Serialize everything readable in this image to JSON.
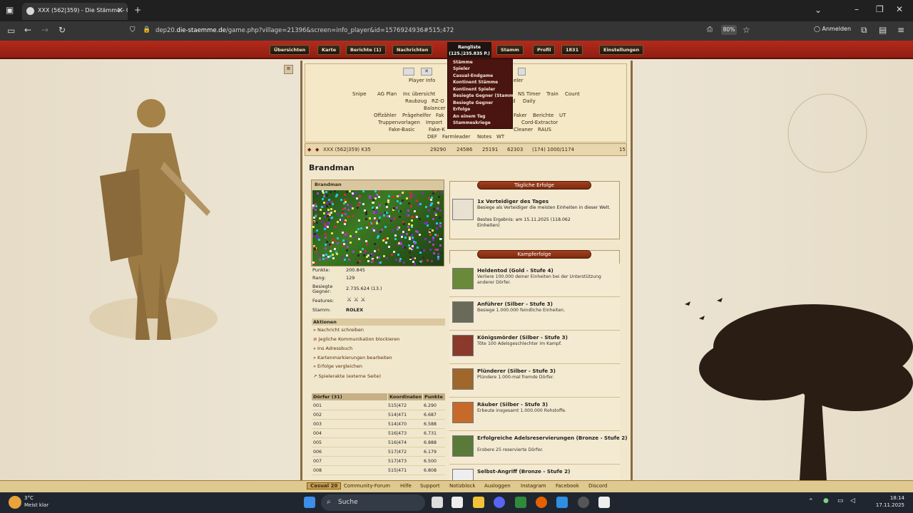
{
  "browser": {
    "tab_title": "XXX (562|359) - Die Stämme - C",
    "url_prefix": "dep20.",
    "url_domain": "die-staemme.de",
    "url_path": "/game.php?village=21396&screen=info_player&id=1576924936#515;472",
    "zoom": "80%",
    "signin": "Anmelden"
  },
  "topbar": {
    "items": [
      "Übersichten",
      "Karte",
      "Berichte (1)",
      "Nachrichten",
      "Stamm",
      "Profil",
      "1831",
      "Einstellungen"
    ],
    "ranking_label": "Rangliste",
    "ranking_sub": "(125.|235.835 P.)"
  },
  "ranking_menu": [
    "Stämme",
    "Spieler",
    "Casual-Endgame",
    "Kontinent Stämme",
    "Kontinent Spieler",
    "Besiegte Gegner (Stamm)",
    "Besiegte Gegner",
    "Erfolge",
    "An einem Tag",
    "Stammeskriege"
  ],
  "tools": {
    "r1": "Player Info",
    "r1b": "eler",
    "r2": [
      "Snipe",
      "AG Plan",
      "Inc übersicht"
    ],
    "r2b": [
      "NS Timer",
      "Train",
      "Count"
    ],
    "r3": [
      "Raubzug",
      "RZ-O"
    ],
    "r3b": [
      "d",
      "Daily"
    ],
    "r4": "Balancer",
    "r5": [
      "Offzähler",
      "Prägehelfer",
      "Fak"
    ],
    "r5b": [
      "Faker",
      "Berichte",
      "UT"
    ],
    "r6": [
      "Truppenvorlagen",
      "Import"
    ],
    "r6b": "Cord-Extractor",
    "r7": [
      "Fake-Basic",
      "Fake-K"
    ],
    "r7b": [
      "Cleaner",
      "RAUS"
    ],
    "r8": [
      "DEF",
      "Farmleader",
      "Notes",
      "WT"
    ]
  },
  "infobar": {
    "village": "XXX (562|359) K35",
    "wood": "29290",
    "clay": "24586",
    "iron": "25191",
    "storage": "62303",
    "pop": "(174) 1000/1174",
    "count": "15"
  },
  "player": {
    "name": "Brandman",
    "card_name": "Brandman",
    "labels": {
      "points": "Punkte:",
      "rank": "Rang:",
      "defeated": "Besiegte Gegner:",
      "features": "Features:",
      "tribe": "Stamm:"
    },
    "points": "200.845",
    "rank": "129",
    "defeated": "2.735.624 (13.)",
    "tribe": "ROLEX"
  },
  "actions": {
    "title": "Aktionen",
    "items": [
      "Nachricht schreiben",
      "Jegliche Kommunikation blockieren",
      "Ins Adressbuch",
      "Kartenmarkierungen bearbeiten",
      "Erfolge vergleichen",
      "Spielerakte (externe Seite)"
    ]
  },
  "villages": {
    "headers": [
      "Dörfer (31)",
      "Koordinaten",
      "Punkte"
    ],
    "rows": [
      {
        "name": "001",
        "coords": "515|472",
        "points": "6.290"
      },
      {
        "name": "002",
        "coords": "514|471",
        "points": "6.687"
      },
      {
        "name": "003",
        "coords": "514|470",
        "points": "6.588"
      },
      {
        "name": "004",
        "coords": "516|473",
        "points": "6.731"
      },
      {
        "name": "005",
        "coords": "516|474",
        "points": "6.888"
      },
      {
        "name": "006",
        "coords": "517|472",
        "points": "6.179"
      },
      {
        "name": "007",
        "coords": "517|473",
        "points": "6.500"
      },
      {
        "name": "008",
        "coords": "515|471",
        "points": "6.808"
      }
    ]
  },
  "daily": {
    "title": "Tägliche Erfolge",
    "name": "1x Verteidiger des Tages",
    "desc": "Besiege als Verteidiger die meisten Einheiten in dieser Welt.",
    "best": "Bestes Ergebnis: am 15.11.2025 (118.062 Einheiten)"
  },
  "combat": {
    "title": "Kampferfolge",
    "items": [
      {
        "name": "Heldentod (Gold - Stufe 4)",
        "desc": "Verliere 100.000 deiner Einheiten bei der Unterstützung anderer Dörfer."
      },
      {
        "name": "Anführer (Silber - Stufe 3)",
        "desc": "Besiege 1.000.000 feindliche Einheiten."
      },
      {
        "name": "Königsmörder (Silber - Stufe 3)",
        "desc": "Töte 100 Adelsgeschlechter im Kampf."
      },
      {
        "name": "Plünderer (Silber - Stufe 3)",
        "desc": "Plündere 1.000-mal fremde Dörfer."
      },
      {
        "name": "Räuber (Silber - Stufe 3)",
        "desc": "Erbeute insgesamt 1.000.000 Rohstoffe."
      },
      {
        "name": "Erfolgreiche Adelsreservierungen (Bronze - Stufe 2)",
        "desc": "Erobere 25 reservierte Dörfer."
      },
      {
        "name": "Selbst-Angriff (Bronze - Stufe 2)",
        "desc": ""
      }
    ]
  },
  "footer": [
    "Casual 20",
    "Community-Forum",
    "Hilfe",
    "Support",
    "Notizblock",
    "Ausloggen",
    "Instagram",
    "Facebook",
    "Discord"
  ],
  "taskbar": {
    "temp": "3°C",
    "weather": "Meist klar",
    "search": "Suche",
    "time": "18:14",
    "date": "17.11.2025"
  }
}
